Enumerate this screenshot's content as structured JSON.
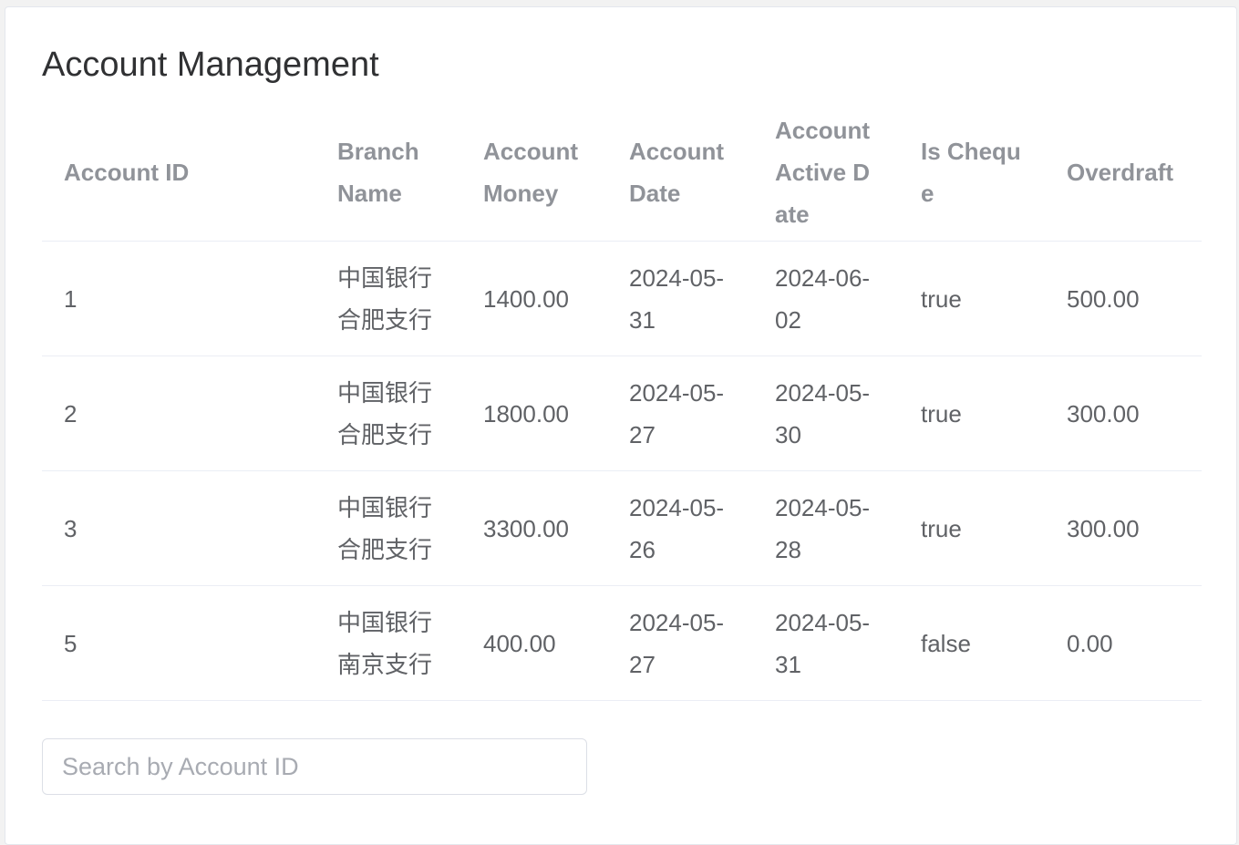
{
  "page": {
    "title": "Account Management"
  },
  "table": {
    "headers": [
      "Account ID",
      "Branch Name",
      "Account Money",
      "Account Date",
      "Account Active Date",
      "Is Cheque",
      "Overdraft"
    ],
    "rows": [
      [
        "1",
        "中国银行合肥支行",
        "1400.00",
        "2024-05-31",
        "2024-06-02",
        "true",
        "500.00"
      ],
      [
        "2",
        "中国银行合肥支行",
        "1800.00",
        "2024-05-27",
        "2024-05-30",
        "true",
        "300.00"
      ],
      [
        "3",
        "中国银行合肥支行",
        "3300.00",
        "2024-05-26",
        "2024-05-28",
        "true",
        "300.00"
      ],
      [
        "5",
        "中国银行南京支行",
        "400.00",
        "2024-05-27",
        "2024-05-31",
        "false",
        "0.00"
      ]
    ]
  },
  "search": {
    "placeholder": "Search by Account ID",
    "value": ""
  },
  "colors": {
    "header_text": "#909399",
    "cell_text": "#606266",
    "title_text": "#303133",
    "row_divider": "#ebeef5"
  }
}
